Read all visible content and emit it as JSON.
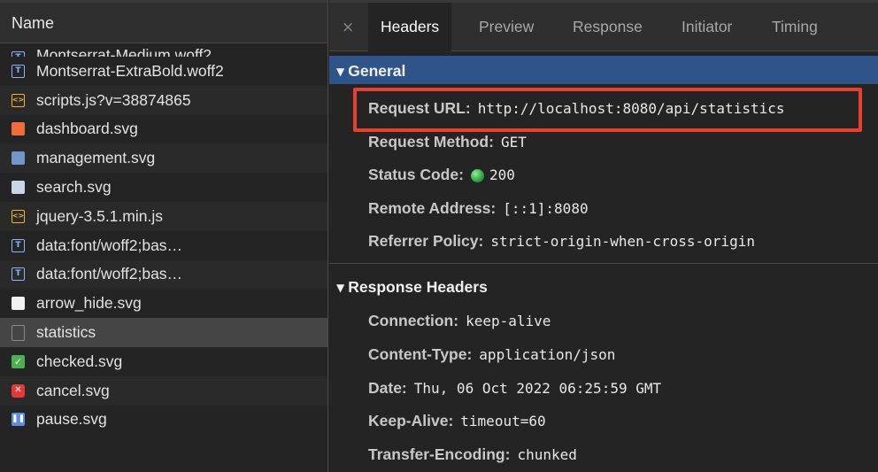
{
  "left": {
    "column_header": "Name",
    "files": [
      {
        "name": "Montserrat-Medium.woff2",
        "icon": "font-icon"
      },
      {
        "name": "Montserrat-ExtraBold.woff2",
        "icon": "font-icon"
      },
      {
        "name": "scripts.js?v=38874865",
        "icon": "script-icon"
      },
      {
        "name": "dashboard.svg",
        "icon": "home-image-icon"
      },
      {
        "name": "management.svg",
        "icon": "image-icon"
      },
      {
        "name": "search.svg",
        "icon": "image-icon"
      },
      {
        "name": "jquery-3.5.1.min.js",
        "icon": "script-icon"
      },
      {
        "name": "data:font/woff2;bas…",
        "icon": "font-icon"
      },
      {
        "name": "data:font/woff2;bas…",
        "icon": "font-icon"
      },
      {
        "name": "arrow_hide.svg",
        "icon": "image-icon"
      },
      {
        "name": "statistics",
        "icon": "document-icon"
      },
      {
        "name": "checked.svg",
        "icon": "check-icon"
      },
      {
        "name": "cancel.svg",
        "icon": "cancel-icon"
      },
      {
        "name": "pause.svg",
        "icon": "pause-icon"
      }
    ]
  },
  "tabs": {
    "close": "×",
    "items": [
      "Headers",
      "Preview",
      "Response",
      "Initiator",
      "Timing"
    ]
  },
  "general": {
    "title": "General",
    "rows": [
      {
        "key": "Request URL:",
        "value": "http://localhost:8080/api/statistics"
      },
      {
        "key": "Request Method:",
        "value": "GET"
      },
      {
        "key": "Status Code:",
        "value": "200"
      },
      {
        "key": "Remote Address:",
        "value": "[::1]:8080"
      },
      {
        "key": "Referrer Policy:",
        "value": "strict-origin-when-cross-origin"
      }
    ]
  },
  "response_headers": {
    "title": "Response Headers",
    "rows": [
      {
        "key": "Connection:",
        "value": "keep-alive"
      },
      {
        "key": "Content-Type:",
        "value": "application/json"
      },
      {
        "key": "Date:",
        "value": "Thu, 06 Oct 2022 06:25:59 GMT"
      },
      {
        "key": "Keep-Alive:",
        "value": "timeout=60"
      },
      {
        "key": "Transfer-Encoding:",
        "value": "chunked"
      }
    ]
  },
  "colors": {
    "highlight": "#e8402b",
    "general_header_bg": "#2f5489",
    "status_ok": "#2ea043"
  }
}
